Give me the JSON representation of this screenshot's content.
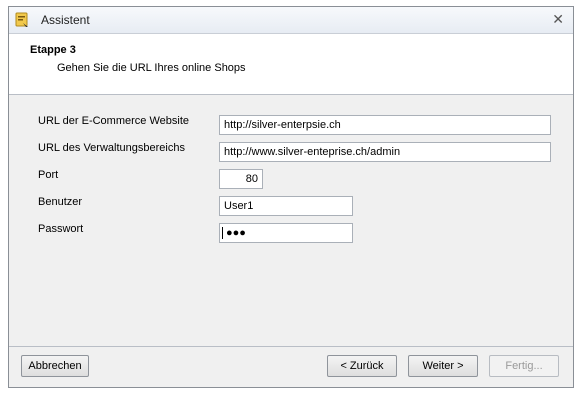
{
  "window": {
    "title": "Assistent"
  },
  "header": {
    "step_title": "Etappe 3",
    "step_subtitle": "Gehen Sie die URL Ihres online Shops"
  },
  "form": {
    "ecommerce_url": {
      "label": "URL der E-Commerce Website",
      "value": "http://silver-enterpsie.ch"
    },
    "admin_url": {
      "label": "URL des Verwaltungsbereichs",
      "value": "http://www.silver-enteprise.ch/admin"
    },
    "port": {
      "label": "Port",
      "value": "80"
    },
    "user": {
      "label": "Benutzer",
      "value": "User1"
    },
    "password": {
      "label": "Passwort",
      "value": "●●●"
    }
  },
  "buttons": {
    "cancel": "Abbrechen",
    "back": "< Zurück",
    "next": "Weiter >",
    "finish": "Fertig..."
  }
}
